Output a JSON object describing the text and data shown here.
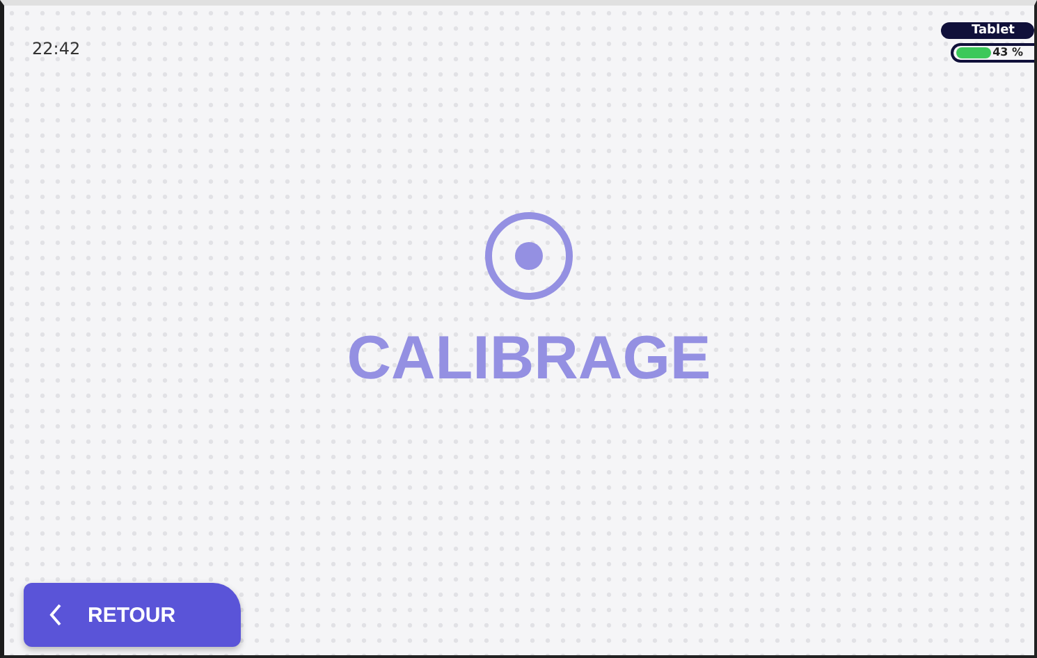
{
  "status_bar": {
    "time": "22:42",
    "device": {
      "label": "Tablet",
      "level": 0.43,
      "reading": "43 %"
    }
  },
  "title": "CALIBRAGE",
  "back_button": {
    "label": "RETOUR"
  }
}
